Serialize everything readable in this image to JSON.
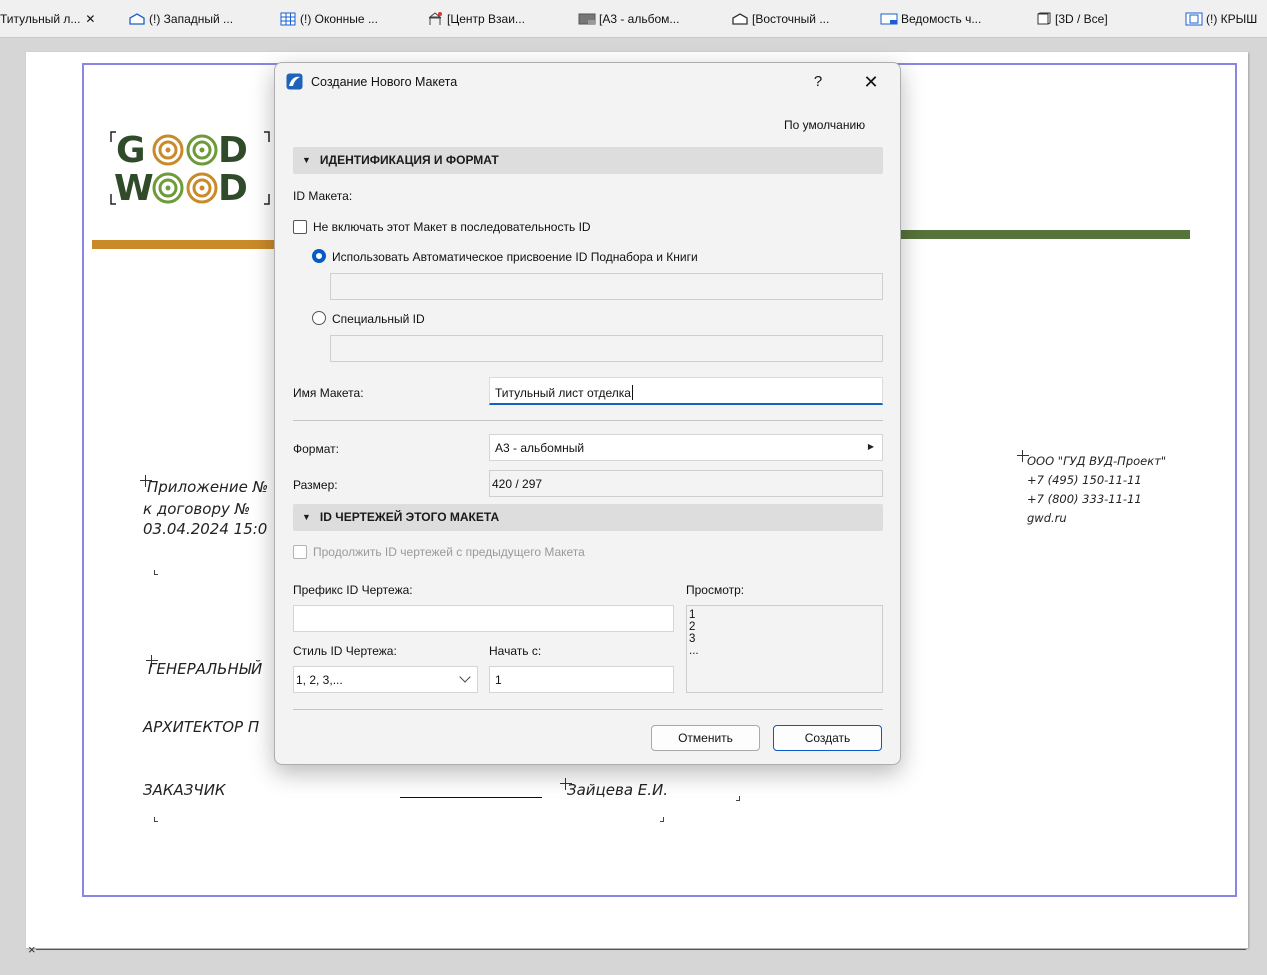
{
  "tabs": [
    {
      "label": "Титульный л...",
      "icon": "layout-icon",
      "closable": true
    },
    {
      "label": "(!) Западный ...",
      "icon": "elevation-icon"
    },
    {
      "label": "(!) Оконные ...",
      "icon": "schedule-grid-icon"
    },
    {
      "label": "[Центр Взаи...",
      "icon": "tower-icon"
    },
    {
      "label": "[А3 - альбом...",
      "icon": "layout-sheet-icon"
    },
    {
      "label": "[Восточный ...",
      "icon": "elevation-icon"
    },
    {
      "label": "Ведомость ч...",
      "icon": "schedule-sheet-icon"
    },
    {
      "label": "[3D / Все]",
      "icon": "3d-window-icon"
    },
    {
      "label": "(!) КРЫШ",
      "icon": "roof-icon"
    }
  ],
  "sheet": {
    "logo_line1": "GOOD",
    "logo_line2": "WOOD",
    "appendix_lines": [
      "Приложение №",
      "к договору №",
      "03.04.2024  15:0"
    ],
    "general_line": "ГЕНЕРАЛЬНЫЙ",
    "architect_line": "АРХИТЕКТОР П",
    "customer_label": "ЗАКАЗЧИК",
    "customer_name": "Зайцева Е.И.",
    "company_lines": [
      "ООО \"ГУД ВУД-Проект\"",
      "+7 (495) 150-11-11",
      "+7 (800) 333-11-11",
      "gwd.ru"
    ],
    "colors": {
      "orange_bar": "#c98a2a",
      "green_bar": "#56733b",
      "frame": "#8b86e3"
    }
  },
  "dialog": {
    "title": "Создание Нового Макета",
    "help_label": "?",
    "close_label": "✕",
    "preset_label": "По умолчанию",
    "section_identification": "ИДЕНТИФИКАЦИЯ И ФОРМАТ",
    "layout_id_label": "ID Макета:",
    "exclude_checkbox_label": "Не включать этот Макет в последовательность ID",
    "exclude_checked": false,
    "radio_auto_label": "Использовать Автоматическое присвоение ID Поднабора и Книги",
    "radio_auto_checked": true,
    "auto_id_value": "",
    "radio_custom_label": "Специальный ID",
    "custom_id_value": "",
    "name_label": "Имя Макета:",
    "name_value": "Титульный лист отделка",
    "format_label": "Формат:",
    "format_value": "А3 - альбомный",
    "size_label": "Размер:",
    "size_value": "420 / 297",
    "section_drawing_ids": "ID ЧЕРТЕЖЕЙ ЭТОГО МАКЕТА",
    "continue_checkbox_label": "Продолжить ID чертежей с предыдущего Макета",
    "continue_checked": false,
    "prefix_label": "Префикс ID Чертежа:",
    "prefix_value": "",
    "style_label": "Стиль ID Чертежа:",
    "style_value": "1, 2, 3,...",
    "start_label": "Начать с:",
    "start_value": "1",
    "preview_label": "Просмотр:",
    "preview_lines": [
      "1",
      "2",
      "3",
      "..."
    ],
    "cancel_label": "Отменить",
    "create_label": "Создать",
    "accent_color": "#0a59c6"
  }
}
